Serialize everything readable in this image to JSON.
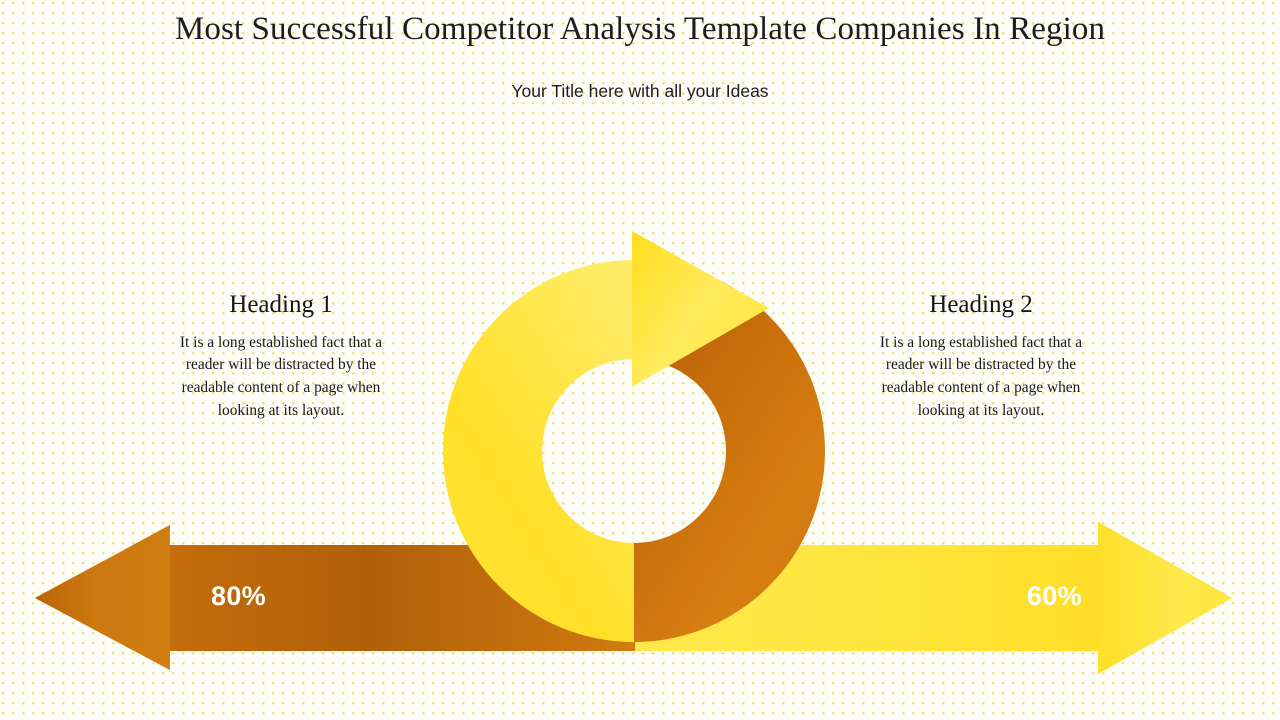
{
  "slide": {
    "title": "Most Successful  Competitor Analysis Template Companies In Region",
    "subtitle": "Your Title here with all your Ideas",
    "background_color": "#fdfdf7",
    "dot_color": "#f6dd72"
  },
  "columns": [
    {
      "heading": "Heading 1",
      "body": "It is a long established fact that a reader will be distracted by the readable content of a page when looking at its layout."
    },
    {
      "heading": "Heading 2",
      "body": "It is a long established fact that a reader will be distracted by the readable content of a page when looking at its layout."
    }
  ],
  "chart_data": {
    "type": "bar",
    "title": "Most Successful  Competitor Analysis Template Companies In Region",
    "subtitle": "Your Title here with all your Ideas",
    "categories": [
      "Heading 1",
      "Heading 2"
    ],
    "values": [
      80,
      60
    ],
    "value_labels": [
      "80%",
      "60%"
    ],
    "unit": "%",
    "series": [
      {
        "name": "Heading 1",
        "value": 80,
        "label": "80%",
        "color": "#c8700f",
        "direction": "left"
      },
      {
        "name": "Heading 2",
        "value": 60,
        "label": "60%",
        "color": "#ffe033",
        "direction": "right"
      }
    ],
    "xlabel": "",
    "ylabel": "",
    "ylim": [
      0,
      100
    ],
    "grid": false,
    "legend": "none"
  },
  "graphic": {
    "ring_label": "circular-process-arrow",
    "colors": {
      "yellow_light": "#fff06b",
      "yellow": "#ffe22e",
      "yellow_deep": "#fcd21a",
      "orange": "#d5790f",
      "orange_dark": "#a85c06",
      "orange_mid": "#c26e0c"
    },
    "arrow_left": {
      "label": "80%",
      "direction": "left",
      "color": "#c8700f"
    },
    "arrow_right": {
      "label": "60%",
      "direction": "right",
      "color": "#ffe033"
    },
    "arrowhead_top": {
      "direction": "right",
      "color": "#ffe22e"
    }
  }
}
